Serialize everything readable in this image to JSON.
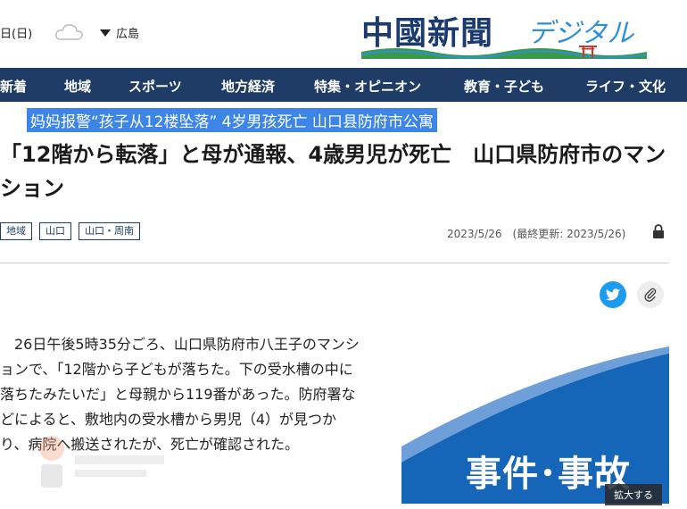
{
  "header": {
    "date": "日(日)",
    "weather_icon": "cloud-icon",
    "region": "広島",
    "logo_main": "中國新聞",
    "logo_sub": "デジタル"
  },
  "nav": {
    "items": [
      "新着",
      "地域",
      "スポーツ",
      "地方経済",
      "特集・オピニオン",
      "教育・子ども",
      "ライフ・文化"
    ]
  },
  "translation": "妈妈报警“孩子从12楼坠落” 4岁男孩死亡 山口县防府市公寓",
  "article": {
    "headline": "「12階から転落」と母が通報、4歳男児が死亡　山口県防府市のマンション",
    "tags": [
      "地域",
      "山口",
      "山口・周南"
    ],
    "dateline": "2023/5/26　(最終更新: 2023/5/26)",
    "body": "26日午後5時35分ごろ、山口県防府市八王子のマンションで、「12階から子どもが落ちた。下の受水槽の中に落ちたみたいだ」と母親から119番があった。防府署などによると、敷地内の受水槽から男児（4）が見つかり、病院へ搬送されたが、死亡が確認された。"
  },
  "figure": {
    "label": "事件･事故",
    "zoom_label": "拡大する"
  },
  "colors": {
    "nav_bg": "#1e3c66",
    "translation_bg": "#3d86e8",
    "twitter": "#1d9bf0",
    "figure_blue": "#1f6fc0"
  }
}
